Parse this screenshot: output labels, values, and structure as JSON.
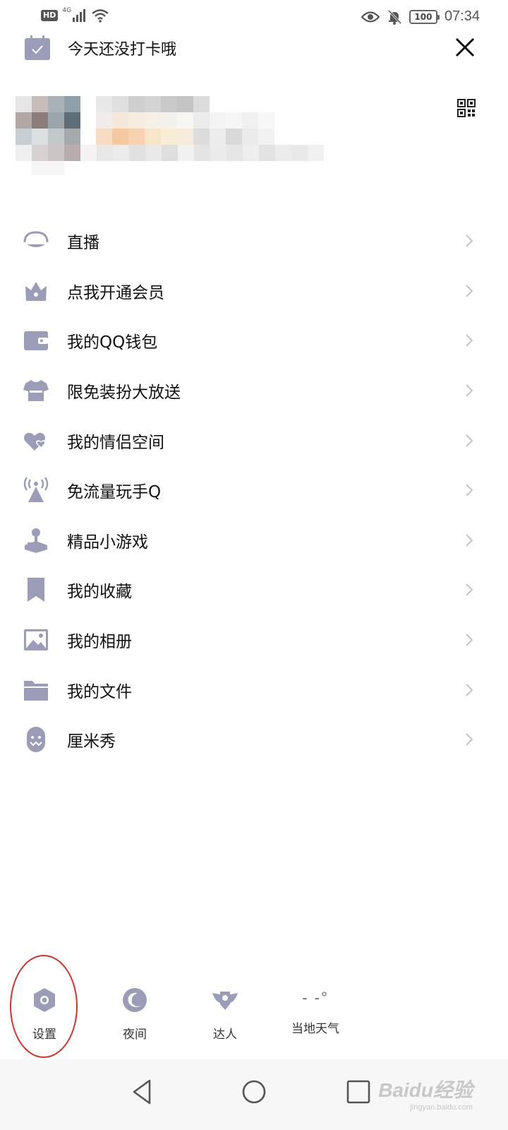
{
  "status_bar": {
    "hd": "HD",
    "network": "4G",
    "battery": "100",
    "time": "07:34"
  },
  "checkin": {
    "text": "今天还没打卡哦"
  },
  "menu": {
    "items": [
      {
        "label": "直播",
        "icon": "live-icon"
      },
      {
        "label": "点我开通会员",
        "icon": "crown-icon"
      },
      {
        "label": "我的QQ钱包",
        "icon": "wallet-icon"
      },
      {
        "label": "限免装扮大放送",
        "icon": "shirt-icon"
      },
      {
        "label": "我的情侣空间",
        "icon": "hearts-icon"
      },
      {
        "label": "免流量玩手Q",
        "icon": "antenna-icon"
      },
      {
        "label": "精品小游戏",
        "icon": "joystick-icon"
      },
      {
        "label": "我的收藏",
        "icon": "bookmark-icon"
      },
      {
        "label": "我的相册",
        "icon": "photo-icon"
      },
      {
        "label": "我的文件",
        "icon": "folder-icon"
      },
      {
        "label": "厘米秀",
        "icon": "avatar-face-icon"
      }
    ]
  },
  "toolbar": {
    "settings": "设置",
    "night": "夜间",
    "expert": "达人",
    "weather": "当地天气",
    "weather_temp": "- -°"
  },
  "watermark": {
    "main": "Baidu经验",
    "sub": "jingyan.baidu.com"
  },
  "colors": {
    "icon": "#9b9cb8",
    "highlight": "#d7302c",
    "chevron": "#c4c4c4"
  }
}
